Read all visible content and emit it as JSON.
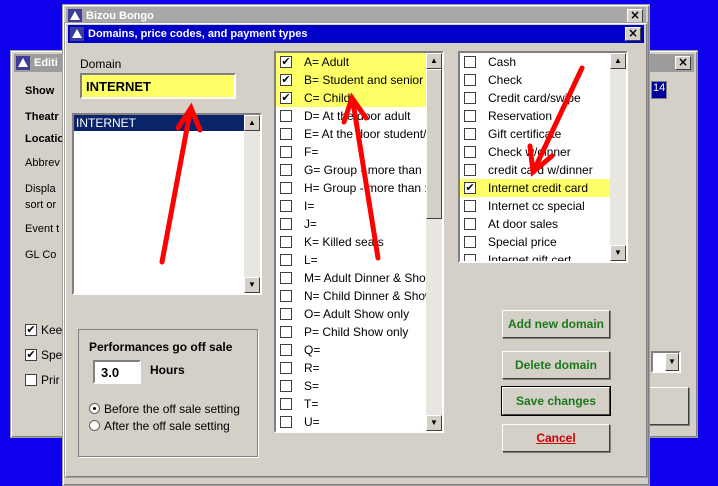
{
  "outer_window": {
    "title": "Bizou Bongo",
    "close_glyph": "×"
  },
  "background_window": {
    "title": "Editi",
    "close_glyph": "×",
    "labels": [
      "Show",
      "Theatr",
      "Locatio",
      "Abbrev",
      "Displa",
      "sort or",
      "Event t",
      "GL Co"
    ],
    "field_value": "14",
    "checkboxes": [
      {
        "label": "Kee",
        "checked": true
      },
      {
        "label": "Spe",
        "checked": true
      },
      {
        "label": "Prir",
        "checked": false
      }
    ]
  },
  "dialog": {
    "title": "Domains, price codes, and payment types",
    "close_glyph": "×",
    "domain_label": "Domain",
    "domain_value": "INTERNET",
    "domain_list": [
      "INTERNET"
    ],
    "price_codes": [
      {
        "label": "A= Adult",
        "checked": true,
        "highlight": true
      },
      {
        "label": "B= Student and senior",
        "checked": true,
        "highlight": true
      },
      {
        "label": "C= Child",
        "checked": true,
        "highlight": true
      },
      {
        "label": "D= At the door adult",
        "checked": false,
        "highlight": false
      },
      {
        "label": "E= At the door student/",
        "checked": false,
        "highlight": false
      },
      {
        "label": "F=",
        "checked": false,
        "highlight": false
      },
      {
        "label": "G= Group - more than",
        "checked": false,
        "highlight": false
      },
      {
        "label": "H= Group - more than :",
        "checked": false,
        "highlight": false
      },
      {
        "label": "I=",
        "checked": false,
        "highlight": false
      },
      {
        "label": "J=",
        "checked": false,
        "highlight": false
      },
      {
        "label": "K= Killed seats",
        "checked": false,
        "highlight": false
      },
      {
        "label": "L=",
        "checked": false,
        "highlight": false
      },
      {
        "label": "M= Adult Dinner & Show",
        "checked": false,
        "highlight": false
      },
      {
        "label": "N= Child Dinner & Show",
        "checked": false,
        "highlight": false
      },
      {
        "label": "O= Adult Show only",
        "checked": false,
        "highlight": false
      },
      {
        "label": "P= Child Show only",
        "checked": false,
        "highlight": false
      },
      {
        "label": "Q=",
        "checked": false,
        "highlight": false
      },
      {
        "label": "R=",
        "checked": false,
        "highlight": false
      },
      {
        "label": "S=",
        "checked": false,
        "highlight": false
      },
      {
        "label": "T=",
        "checked": false,
        "highlight": false
      },
      {
        "label": "U=",
        "checked": false,
        "highlight": false
      }
    ],
    "payment_types": [
      {
        "label": "Cash",
        "checked": false,
        "highlight": false
      },
      {
        "label": "Check",
        "checked": false,
        "highlight": false
      },
      {
        "label": "Credit card/swipe",
        "checked": false,
        "highlight": false
      },
      {
        "label": "Reservation",
        "checked": false,
        "highlight": false
      },
      {
        "label": "Gift certificate",
        "checked": false,
        "highlight": false
      },
      {
        "label": "Check w/dinner",
        "checked": false,
        "highlight": false
      },
      {
        "label": "credit card w/dinner",
        "checked": false,
        "highlight": false
      },
      {
        "label": "Internet credit card",
        "checked": true,
        "highlight": true
      },
      {
        "label": "Internet cc special",
        "checked": false,
        "highlight": false
      },
      {
        "label": "At door sales",
        "checked": false,
        "highlight": false
      },
      {
        "label": "Special price",
        "checked": false,
        "highlight": false
      },
      {
        "label": "Internet gift cert",
        "checked": false,
        "highlight": false
      }
    ],
    "off_sale": {
      "heading": "Performances go off sale",
      "hours_value": "3.0",
      "hours_label": "Hours",
      "radio_before": "Before the off sale setting",
      "radio_after": "After the off sale setting",
      "selected": "before"
    },
    "buttons": {
      "add": "Add new domain",
      "delete": "Delete domain",
      "save": "Save changes",
      "cancel": "Cancel"
    },
    "check_glyph": "✔",
    "arrow_up_glyph": "▲",
    "arrow_down_glyph": "▼"
  },
  "colors": {
    "desktop": "#0f00ee",
    "highlight": "#ffff66",
    "annotation_arrow": "#ff0000",
    "button_text_green": "#1a7a1a",
    "cancel_text": "#cc0000"
  }
}
